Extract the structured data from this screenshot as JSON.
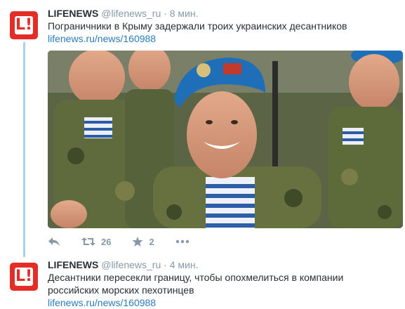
{
  "tweets": [
    {
      "author_name": "LIFENEWS",
      "handle": "@lifenews_ru",
      "separator": "·",
      "time": "8 мин.",
      "text": "Пограничники в Крыму задержали троих украинских десантников",
      "link": "lifenews.ru/news/160988",
      "avatar_letters": "L!",
      "actions": {
        "retweets": "26",
        "favorites": "2"
      }
    },
    {
      "author_name": "LIFENEWS",
      "handle": "@lifenews_ru",
      "separator": "·",
      "time": "4 мин.",
      "text_line1": "Десантники пересекли границу, чтобы опохмелиться в компании",
      "text_line2": "российских морских пехотинцев",
      "link": "lifenews.ru/news/160988",
      "avatar_letters": "L!"
    }
  ],
  "colors": {
    "brand_red": "#e52d27",
    "link_blue": "#2b7bb9",
    "meta_gray": "#8899a6",
    "thread_line": "#a7d3ea",
    "beret_blue": "#1f6fb8"
  },
  "icons": [
    "reply-icon",
    "retweet-icon",
    "favorite-icon",
    "more-icon"
  ]
}
